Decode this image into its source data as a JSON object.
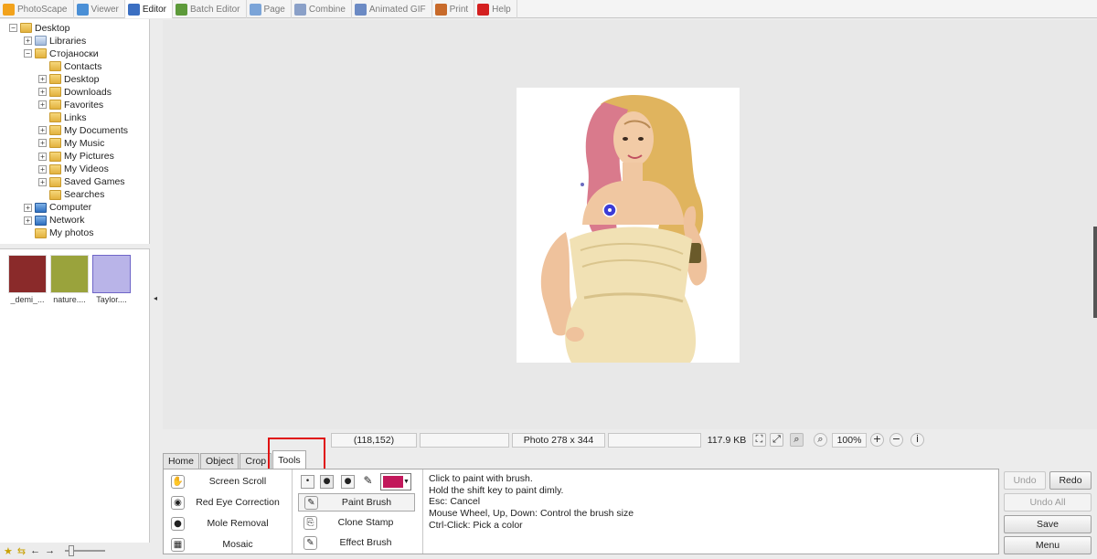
{
  "tabs": [
    {
      "label": "PhotoScape",
      "icon": "photoscape-icon",
      "color": "#f2a21b"
    },
    {
      "label": "Viewer",
      "icon": "viewer-icon",
      "color": "#4a8fd6"
    },
    {
      "label": "Editor",
      "icon": "editor-icon",
      "color": "#3b6fc2"
    },
    {
      "label": "Batch Editor",
      "icon": "batch-editor-icon",
      "color": "#5d9a3a"
    },
    {
      "label": "Page",
      "icon": "page-icon",
      "color": "#7ba4d8"
    },
    {
      "label": "Combine",
      "icon": "combine-icon",
      "color": "#8aa0c8"
    },
    {
      "label": "Animated GIF",
      "icon": "animated-gif-icon",
      "color": "#6b8ac4"
    },
    {
      "label": "Print",
      "icon": "print-icon",
      "color": "#c86a2a"
    },
    {
      "label": "Help",
      "icon": "help-icon",
      "color": "#d42020"
    }
  ],
  "active_tab": "Editor",
  "tree": [
    {
      "label": "Desktop",
      "level": 0,
      "expander": "−",
      "icon": "folder"
    },
    {
      "label": "Libraries",
      "level": 1,
      "expander": "+",
      "icon": "libs"
    },
    {
      "label": "Стојаноски",
      "level": 1,
      "expander": "−",
      "icon": "folder"
    },
    {
      "label": "Contacts",
      "level": 2,
      "expander": "",
      "icon": "folder"
    },
    {
      "label": "Desktop",
      "level": 2,
      "expander": "+",
      "icon": "folder"
    },
    {
      "label": "Downloads",
      "level": 2,
      "expander": "+",
      "icon": "folder"
    },
    {
      "label": "Favorites",
      "level": 2,
      "expander": "+",
      "icon": "folder"
    },
    {
      "label": "Links",
      "level": 2,
      "expander": "",
      "icon": "folder"
    },
    {
      "label": "My Documents",
      "level": 2,
      "expander": "+",
      "icon": "folder"
    },
    {
      "label": "My Music",
      "level": 2,
      "expander": "+",
      "icon": "folder"
    },
    {
      "label": "My Pictures",
      "level": 2,
      "expander": "+",
      "icon": "folder"
    },
    {
      "label": "My Videos",
      "level": 2,
      "expander": "+",
      "icon": "folder"
    },
    {
      "label": "Saved Games",
      "level": 2,
      "expander": "+",
      "icon": "folder"
    },
    {
      "label": "Searches",
      "level": 2,
      "expander": "",
      "icon": "folder"
    },
    {
      "label": "Computer",
      "level": 1,
      "expander": "+",
      "icon": "blue"
    },
    {
      "label": "Network",
      "level": 1,
      "expander": "+",
      "icon": "blue"
    },
    {
      "label": "My photos",
      "level": 1,
      "expander": "",
      "icon": "folder"
    }
  ],
  "thumbnails": [
    {
      "caption": "_demi_...",
      "bg": "#8a2a2a"
    },
    {
      "caption": "nature....",
      "bg": "#9aa33c"
    },
    {
      "caption": "Taylor....",
      "bg": "#b9b4e8"
    }
  ],
  "status": {
    "coords": "(118,152)",
    "photo_size": "Photo 278 x 344",
    "file_size": "117.9 KB",
    "zoom": "100%"
  },
  "panel_tabs": [
    "Home",
    "Object",
    "Crop",
    "Tools"
  ],
  "active_panel_tab": "Tools",
  "tools_left": [
    {
      "label": "Screen Scroll",
      "icon": "hand-icon",
      "glyph": "✋"
    },
    {
      "label": "Red Eye Correction",
      "icon": "red-eye-icon",
      "glyph": "◉"
    },
    {
      "label": "Mole Removal",
      "icon": "mole-removal-icon",
      "glyph": "●"
    },
    {
      "label": "Mosaic",
      "icon": "mosaic-icon",
      "glyph": "▦"
    }
  ],
  "brush_tools": [
    {
      "label": "Paint Brush",
      "icon": "paint-brush-icon",
      "glyph": "✎"
    },
    {
      "label": "Clone Stamp",
      "icon": "clone-stamp-icon",
      "glyph": "⎘"
    },
    {
      "label": "Effect Brush",
      "icon": "effect-brush-icon",
      "glyph": "✎"
    }
  ],
  "active_brush_tool": "Paint Brush",
  "brush_color": "#c2185b",
  "description": [
    "Click to paint with brush.",
    "Hold the shift key to paint dimly.",
    "Esc: Cancel",
    "Mouse Wheel, Up, Down: Control the brush size",
    "Ctrl-Click: Pick a color"
  ],
  "buttons": {
    "undo": "Undo",
    "redo": "Redo",
    "undo_all": "Undo All",
    "save": "Save",
    "menu": "Menu"
  }
}
